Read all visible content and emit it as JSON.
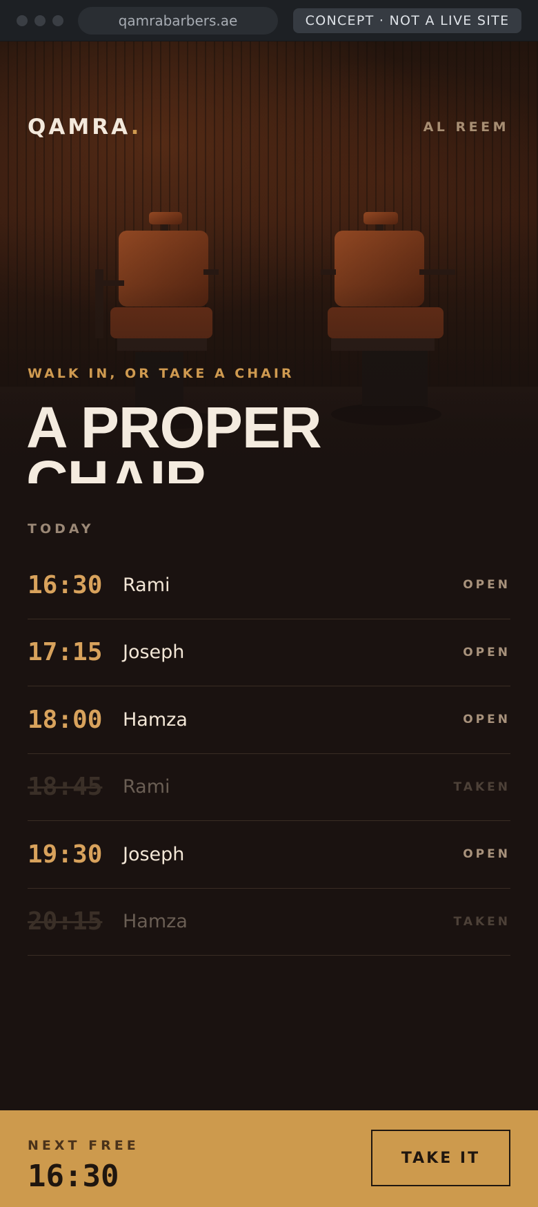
{
  "browser": {
    "url": "qamrabarbers.ae",
    "badge": "CONCEPT · NOT A LIVE SITE"
  },
  "header": {
    "brand": "QAMRA",
    "brand_dot": ".",
    "location": "AL REEM"
  },
  "hero": {
    "kicker": "WALK IN, OR TAKE A CHAIR",
    "headline_line1": "A PROPER",
    "headline_line2": "CHAIR."
  },
  "schedule": {
    "label": "TODAY",
    "slots": [
      {
        "time": "16:30",
        "barber": "Rami",
        "status": "OPEN"
      },
      {
        "time": "17:15",
        "barber": "Joseph",
        "status": "OPEN"
      },
      {
        "time": "18:00",
        "barber": "Hamza",
        "status": "OPEN"
      },
      {
        "time": "18:45",
        "barber": "Rami",
        "status": "TAKEN"
      },
      {
        "time": "19:30",
        "barber": "Joseph",
        "status": "OPEN"
      },
      {
        "time": "20:15",
        "barber": "Hamza",
        "status": "TAKEN"
      }
    ]
  },
  "booking": {
    "label": "NEXT FREE",
    "time": "16:30",
    "button": "TAKE IT"
  },
  "colors": {
    "background": "#1a1210",
    "accent": "#cd9a4d",
    "time_open": "#d8a25c",
    "chair_leather": "#8a3e1c"
  }
}
